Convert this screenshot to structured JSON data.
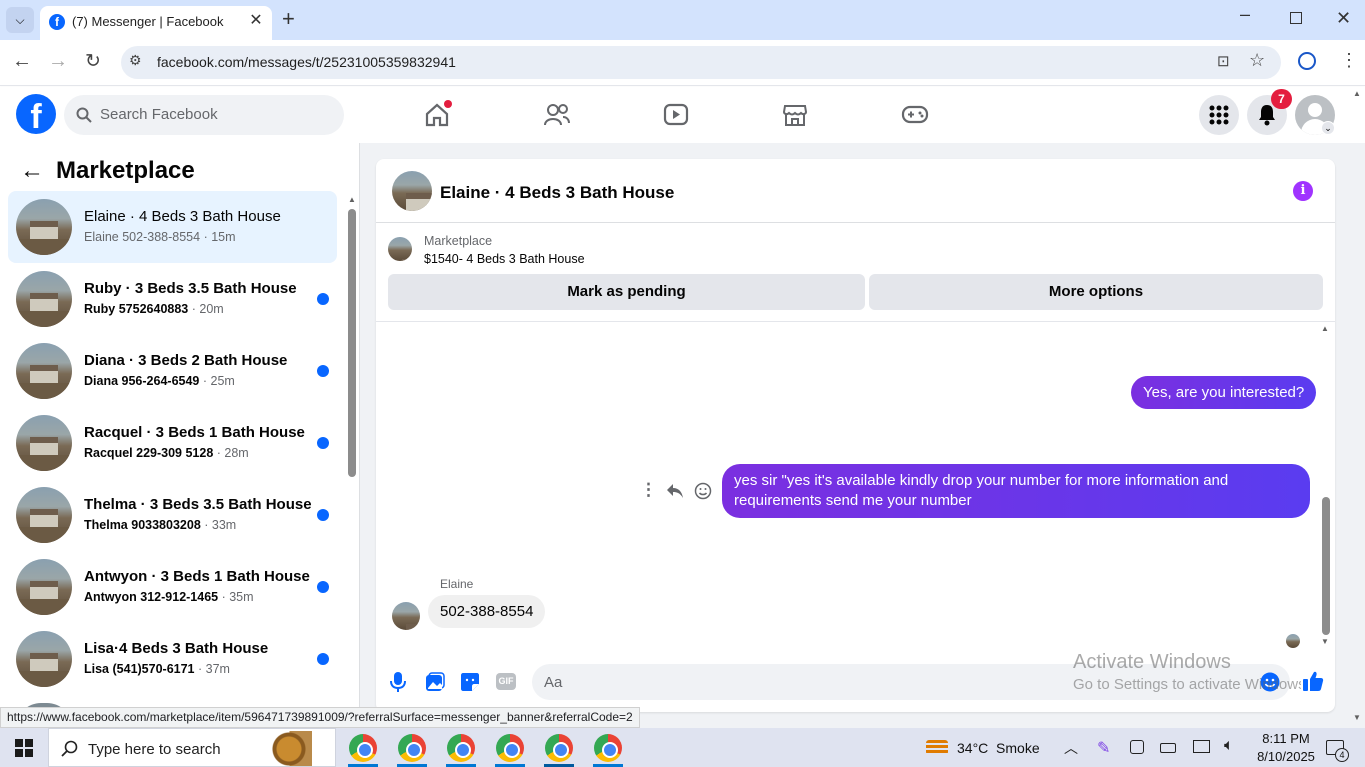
{
  "browser": {
    "tab_title": "(7) Messenger | Facebook",
    "url": "facebook.com/messages/t/25231005359832941"
  },
  "header": {
    "search_placeholder": "Search Facebook",
    "notification_count": "7"
  },
  "sidebar": {
    "title": "Marketplace",
    "conversations": [
      {
        "title": "Elaine · 4 Beds 3 Bath House",
        "name": "Elaine",
        "phone": "502-388-8554",
        "time": "15m",
        "unread": false,
        "active": true
      },
      {
        "title": "Ruby · 3 Beds 3.5 Bath House",
        "name": "Ruby",
        "phone": "5752640883",
        "time": "20m",
        "unread": true
      },
      {
        "title": "Diana · 3 Beds 2 Bath House",
        "name": "Diana",
        "phone": "956-264-6549",
        "time": "25m",
        "unread": true
      },
      {
        "title": "Racquel · 3 Beds 1 Bath House",
        "name": "Racquel",
        "phone": "229-309 5128",
        "time": "28m",
        "unread": true
      },
      {
        "title": "Thelma · 3 Beds 3.5 Bath House",
        "name": "Thelma",
        "phone": "9033803208",
        "time": "33m",
        "unread": true
      },
      {
        "title": "Antwyon · 3 Beds 1 Bath House",
        "name": "Antwyon",
        "phone": "312-912-1465",
        "time": "35m",
        "unread": true
      },
      {
        "title": "Lisa·4 Beds 3 Bath House",
        "name": "Lisa",
        "phone": "(541)570-6171",
        "time": "37m",
        "unread": true
      }
    ]
  },
  "chat": {
    "title": "Elaine · 4 Beds 3 Bath House",
    "listing_label": "Marketplace",
    "listing_title": "$1540- 4 Beds 3 Bath House",
    "mark_pending": "Mark as pending",
    "more_options": "More options",
    "messages": [
      {
        "from": "me",
        "text": "Yes, are you interested?"
      },
      {
        "from": "me",
        "text": "yes sir \"yes it's available kindly drop your number for more information and requirements send me your number"
      },
      {
        "from": "Elaine",
        "sender_label": "Elaine",
        "text": "502-388-8554"
      }
    ],
    "composer_placeholder": "Aa",
    "gif_label": "GIF"
  },
  "watermark": {
    "line1": "Activate Windows",
    "line2": "Go to Settings to activate Windows."
  },
  "status_url": "https://www.facebook.com/marketplace/item/596471739891009/?referralSurface=messenger_banner&referralCode=2",
  "taskbar": {
    "search_placeholder": "Type here to search",
    "weather": "34°C  Smoke",
    "time": "8:11 PM",
    "date": "8/10/2025",
    "notif_count": "4"
  },
  "colors": {
    "fb_blue": "#0866ff",
    "bubble": "#6a36ea",
    "info": "#a033ff"
  }
}
